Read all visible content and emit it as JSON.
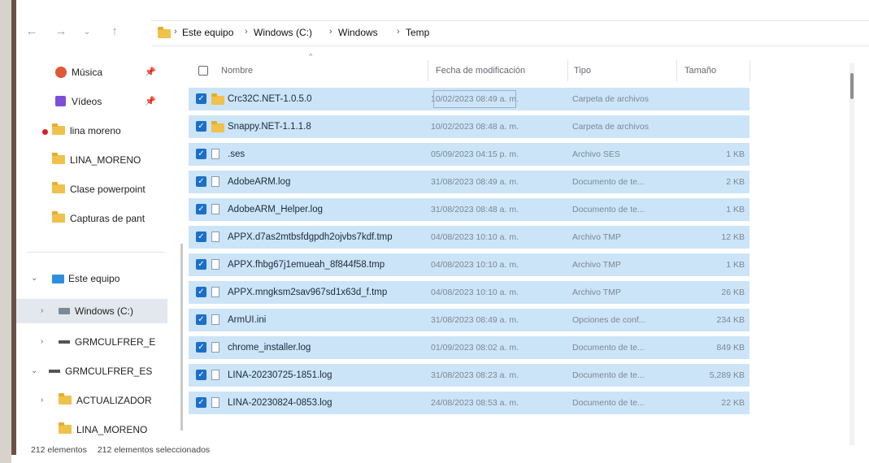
{
  "address": {
    "crumbs": [
      "Este equipo",
      "Windows (C:)",
      "Windows",
      "Temp"
    ]
  },
  "nav": {
    "items": [
      {
        "label": "Música",
        "icon": "music-icon",
        "pinned": true
      },
      {
        "label": "Vídeos",
        "icon": "video-icon",
        "pinned": true
      },
      {
        "label": "lina moreno",
        "icon": "folder-icon",
        "pinned": false
      },
      {
        "label": "LINA_MORENO",
        "icon": "folder-icon",
        "pinned": false
      },
      {
        "label": "Clase powerpoint",
        "icon": "folder-icon",
        "pinned": false
      },
      {
        "label": "Capturas de pant",
        "icon": "folder-icon",
        "pinned": false
      },
      {
        "label": "Este equipo",
        "icon": "pc-icon",
        "expanded": true
      },
      {
        "label": "Windows (C:)",
        "icon": "drive-icon",
        "selected": true
      },
      {
        "label": "GRMCULFRER_E",
        "icon": "drive-icon"
      },
      {
        "label": "GRMCULFRER_ES",
        "icon": "drive-icon",
        "expanded": true
      },
      {
        "label": "ACTUALIZADOR",
        "icon": "folder-icon"
      },
      {
        "label": "LINA_MORENO",
        "icon": "folder-icon"
      }
    ]
  },
  "columns": {
    "name": "Nombre",
    "date": "Fecha de modificación",
    "type": "Tipo",
    "size": "Tamaño"
  },
  "files": [
    {
      "name": "Crc32C.NET-1.0.5.0",
      "date": "10/02/2023 08:49 a. m.",
      "type": "Carpeta de archivos",
      "size": "",
      "icon": "folder"
    },
    {
      "name": "Snappy.NET-1.1.1.8",
      "date": "10/02/2023 08:48 a. m.",
      "type": "Carpeta de archivos",
      "size": "",
      "icon": "folder"
    },
    {
      "name": ".ses",
      "date": "05/09/2023 04:15 p. m.",
      "type": "Archivo SES",
      "size": "1 KB",
      "icon": "file"
    },
    {
      "name": "AdobeARM.log",
      "date": "31/08/2023 08:49 a. m.",
      "type": "Documento de te...",
      "size": "2 KB",
      "icon": "file"
    },
    {
      "name": "AdobeARM_Helper.log",
      "date": "31/08/2023 08:48 a. m.",
      "type": "Documento de te...",
      "size": "1 KB",
      "icon": "file"
    },
    {
      "name": "APPX.d7as2mtbsfdgpdh2ojvbs7kdf.tmp",
      "date": "04/08/2023 10:10 a. m.",
      "type": "Archivo TMP",
      "size": "12 KB",
      "icon": "file"
    },
    {
      "name": "APPX.fhbg67j1emueah_8f844f58.tmp",
      "date": "04/08/2023 10:10 a. m.",
      "type": "Archivo TMP",
      "size": "1 KB",
      "icon": "file"
    },
    {
      "name": "APPX.mngksm2sav967sd1x63d_f.tmp",
      "date": "04/08/2023 10:10 a. m.",
      "type": "Archivo TMP",
      "size": "26 KB",
      "icon": "file"
    },
    {
      "name": "ArmUI.ini",
      "date": "31/08/2023 08:49 a. m.",
      "type": "Opciones de conf...",
      "size": "234 KB",
      "icon": "file"
    },
    {
      "name": "chrome_installer.log",
      "date": "01/09/2023 08:02 a. m.",
      "type": "Documento de te...",
      "size": "849 KB",
      "icon": "file"
    },
    {
      "name": "LINA-20230725-1851.log",
      "date": "31/08/2023 08:23 a. m.",
      "type": "Documento de te...",
      "size": "5,289 KB",
      "icon": "file"
    },
    {
      "name": "LINA-20230824-0853.log",
      "date": "24/08/2023 08:53 a. m.",
      "type": "Documento de te...",
      "size": "22 KB",
      "icon": "file"
    }
  ],
  "status": {
    "count": "212 elementos",
    "selected": "212 elementos seleccionados"
  },
  "colors": {
    "selection": "#cce4f7",
    "checkbox": "#1c6fc9",
    "folder": "#f0c14b"
  }
}
